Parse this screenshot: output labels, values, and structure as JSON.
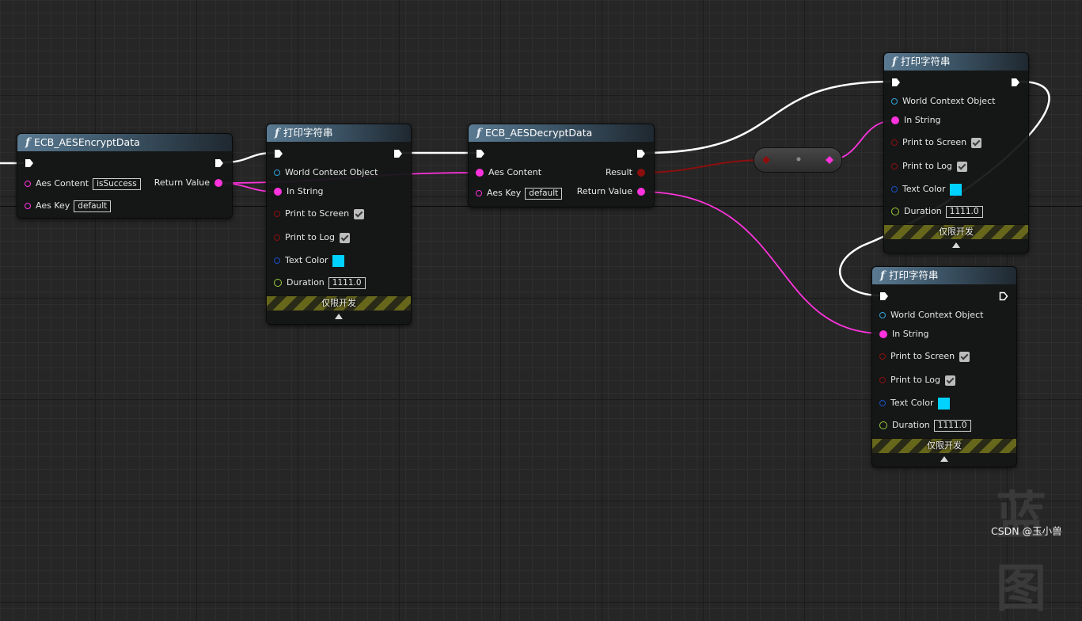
{
  "colors": {
    "exec": "#ffffff",
    "string_pin": "#ff33dd",
    "object_pin": "#2fa3d8",
    "bool_pin": "#8b0f0f",
    "color_pin": "#1a4fc2",
    "float_pin": "#9ccc3c",
    "text_color_swatch": "#00d2ff"
  },
  "nodes": {
    "encrypt": {
      "title": "ECB_AESEncryptData",
      "aes_content_label": "Aes Content",
      "aes_content_value": "isSuccess",
      "aes_key_label": "Aes Key",
      "aes_key_value": "default",
      "return_label": "Return Value"
    },
    "print1": {
      "title": "打印字符串",
      "world_context": "World Context Object",
      "in_string": "In String",
      "print_to_screen": "Print to Screen",
      "print_to_log": "Print to Log",
      "text_color": "Text Color",
      "duration_label": "Duration",
      "duration_value": "1111.0",
      "dev_only": "仅限开发"
    },
    "decrypt": {
      "title": "ECB_AESDecryptData",
      "aes_content_label": "Aes Content",
      "aes_key_label": "Aes Key",
      "aes_key_value": "default",
      "result_label": "Result",
      "return_label": "Return Value"
    },
    "print2": {
      "title": "打印字符串",
      "world_context": "World Context Object",
      "in_string": "In String",
      "print_to_screen": "Print to Screen",
      "print_to_log": "Print to Log",
      "text_color": "Text Color",
      "duration_label": "Duration",
      "duration_value": "1111.0",
      "dev_only": "仅限开发"
    },
    "print3": {
      "title": "打印字符串",
      "world_context": "World Context Object",
      "in_string": "In String",
      "print_to_screen": "Print to Screen",
      "print_to_log": "Print to Log",
      "text_color": "Text Color",
      "duration_label": "Duration",
      "duration_value": "1111.0",
      "dev_only": "仅限开发"
    }
  },
  "watermark": "蓝图",
  "credit": "CSDN @玉小兽"
}
